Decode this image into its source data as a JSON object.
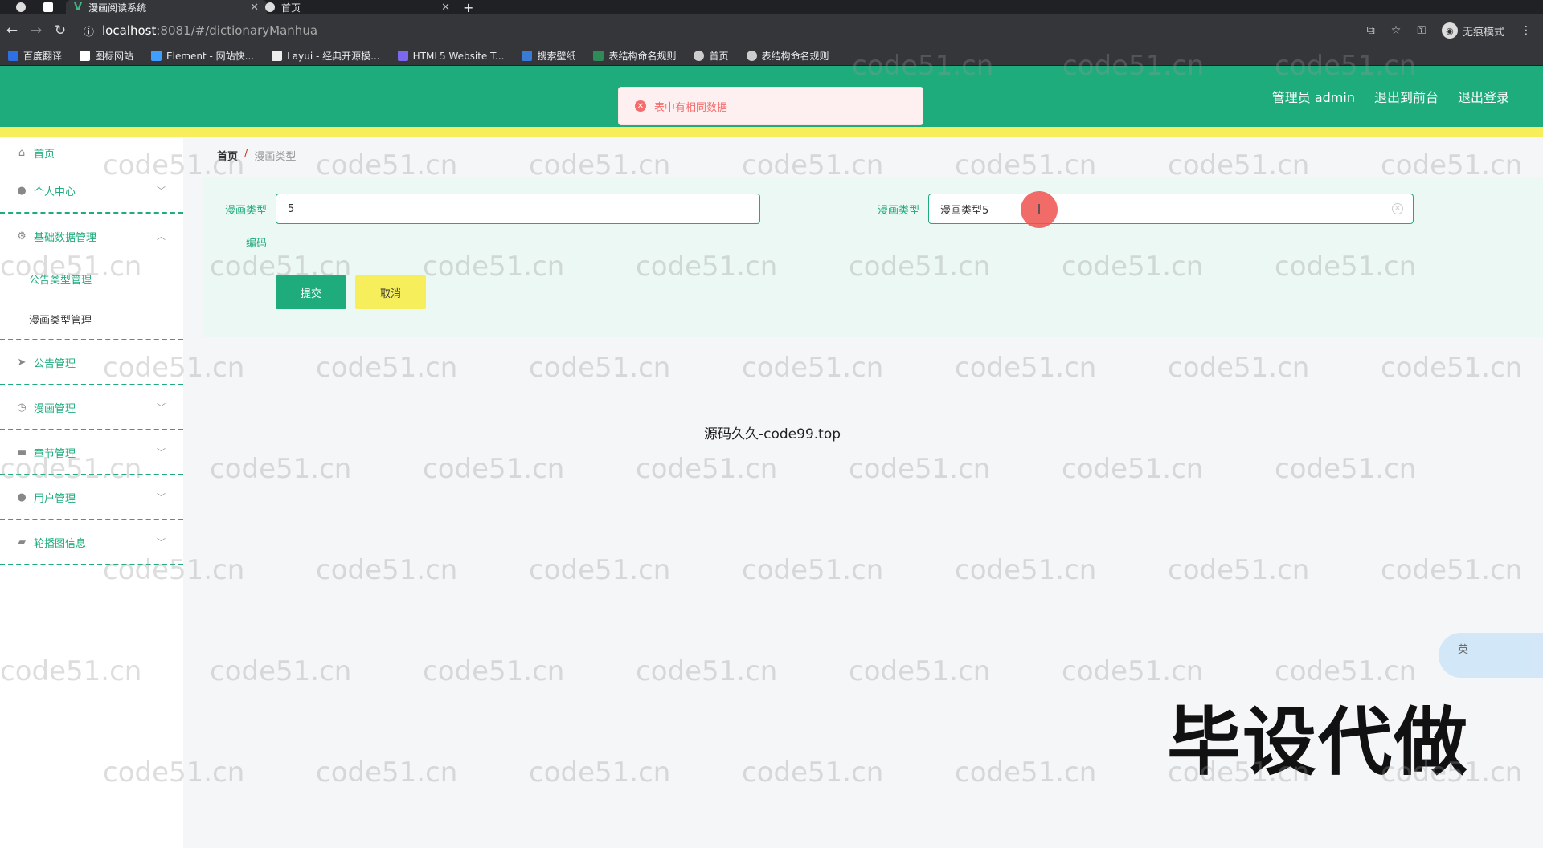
{
  "browser": {
    "tabs": [
      {
        "title": "漫画阅读系统",
        "active": true
      },
      {
        "title": "首页",
        "active": false
      }
    ],
    "new_tab": "+",
    "url_host": "localhost",
    "url_path": ":8081/#/dictionaryManhua",
    "incognito_label": "无痕模式",
    "bookmarks": [
      {
        "label": "百度翻译",
        "color": "#2f6fe4"
      },
      {
        "label": "图标网站",
        "color": "#ffffff"
      },
      {
        "label": "Element - 网站快...",
        "color": "#409eff"
      },
      {
        "label": "Layui - 经典开源模...",
        "color": "#ffffff"
      },
      {
        "label": "HTML5 Website T...",
        "color": "#7b68ee"
      },
      {
        "label": "搜索壁纸",
        "color": "#3a7bd5"
      },
      {
        "label": "表结构命名规则",
        "color": "#2e8b57"
      },
      {
        "label": "首页",
        "color": "#cccccc"
      },
      {
        "label": "表结构命名规则",
        "color": "#cccccc"
      }
    ]
  },
  "header": {
    "admin_label": "管理员 admin",
    "to_front": "退出到前台",
    "logout": "退出登录",
    "bg_color": "#1fac7c",
    "accent_color": "#f6ef5b"
  },
  "toast": {
    "message": "表中有相同数据",
    "type": "error"
  },
  "sidebar": {
    "home": {
      "label": "首页",
      "icon": "home-icon"
    },
    "items": [
      {
        "label": "个人中心",
        "icon": "user-icon"
      },
      {
        "label": "基础数据管理",
        "icon": "gear-icon",
        "expanded": true,
        "children": [
          {
            "label": "公告类型管理",
            "active": false
          },
          {
            "label": "漫画类型管理",
            "active": true
          }
        ]
      },
      {
        "label": "公告管理",
        "icon": "send-icon"
      },
      {
        "label": "漫画管理",
        "icon": "clock-icon"
      },
      {
        "label": "章节管理",
        "icon": "chapter-icon"
      },
      {
        "label": "用户管理",
        "icon": "user-icon"
      },
      {
        "label": "轮播图信息",
        "icon": "image-icon"
      }
    ]
  },
  "breadcrumb": {
    "home": "首页",
    "separator": "/",
    "current": "漫画类型"
  },
  "form": {
    "code_label_line1": "漫画类型",
    "code_label_line2": "编码",
    "code_value": "5",
    "name_label": "漫画类型",
    "name_value": "漫画类型5",
    "submit": "提交",
    "cancel": "取消"
  },
  "overlay": {
    "center_text": "源码久久-code99.top",
    "promo_text": "毕设代做",
    "watermark": "code51.cn",
    "ime_label": "英"
  }
}
